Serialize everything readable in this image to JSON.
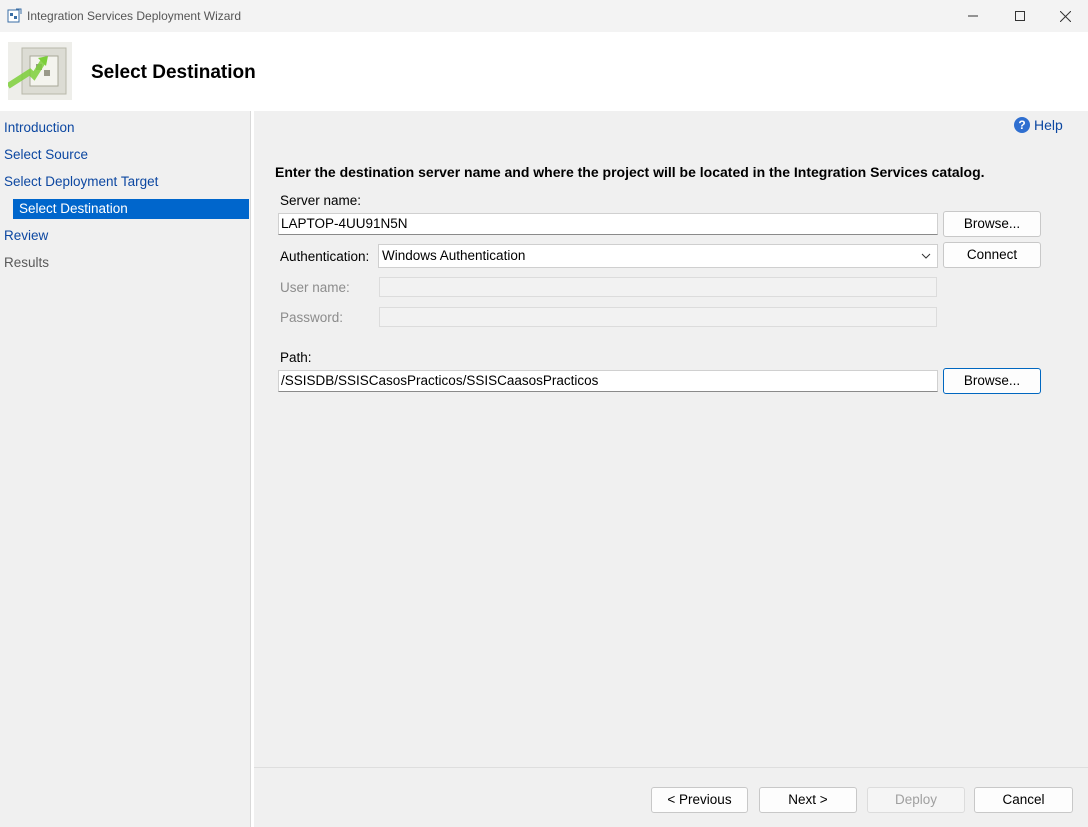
{
  "window": {
    "title": "Integration Services Deployment Wizard"
  },
  "header": {
    "title": "Select Destination"
  },
  "sidebar": {
    "items": [
      {
        "label": "Introduction"
      },
      {
        "label": "Select Source"
      },
      {
        "label": "Select Deployment Target"
      },
      {
        "label": "Select Destination"
      },
      {
        "label": "Review"
      },
      {
        "label": "Results"
      }
    ]
  },
  "main": {
    "help_label": "Help",
    "instruction": "Enter the destination server name and where the project will be located in the Integration Services catalog.",
    "server_name_label": "Server name:",
    "server_name_value": "LAPTOP-4UU91N5N",
    "browse_server_label": "Browse...",
    "authentication_label": "Authentication:",
    "authentication_value": "Windows Authentication",
    "connect_label": "Connect",
    "username_label": "User name:",
    "password_label": "Password:",
    "path_label": "Path:",
    "path_value": "/SSISDB/SSISCasosPracticos/SSISCaasosPracticos",
    "browse_path_label": "Browse..."
  },
  "footer": {
    "previous_label": "< Previous",
    "next_label": "Next >",
    "deploy_label": "Deploy",
    "cancel_label": "Cancel"
  }
}
